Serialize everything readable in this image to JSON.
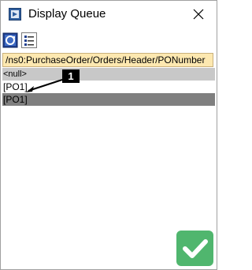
{
  "window": {
    "title": "Display Queue"
  },
  "toolbar": {
    "buttons": [
      "refresh-context-icon",
      "details-list-icon"
    ]
  },
  "path_bar": {
    "text": "/ns0:PurchaseOrder/Orders/Header/PONumber"
  },
  "queue": {
    "rows": [
      {
        "text": "<null>",
        "style": "null"
      },
      {
        "text": "[PO1]",
        "style": "plain"
      },
      {
        "text": "[PO1]",
        "style": "dark"
      }
    ]
  },
  "annotation": {
    "number": "1"
  },
  "colors": {
    "path_bar_bg": "#fde8b0",
    "null_row_bg": "#c8c8c8",
    "selected_row_bg": "#7f7f7f",
    "ok_button_bg": "#50b66e"
  }
}
